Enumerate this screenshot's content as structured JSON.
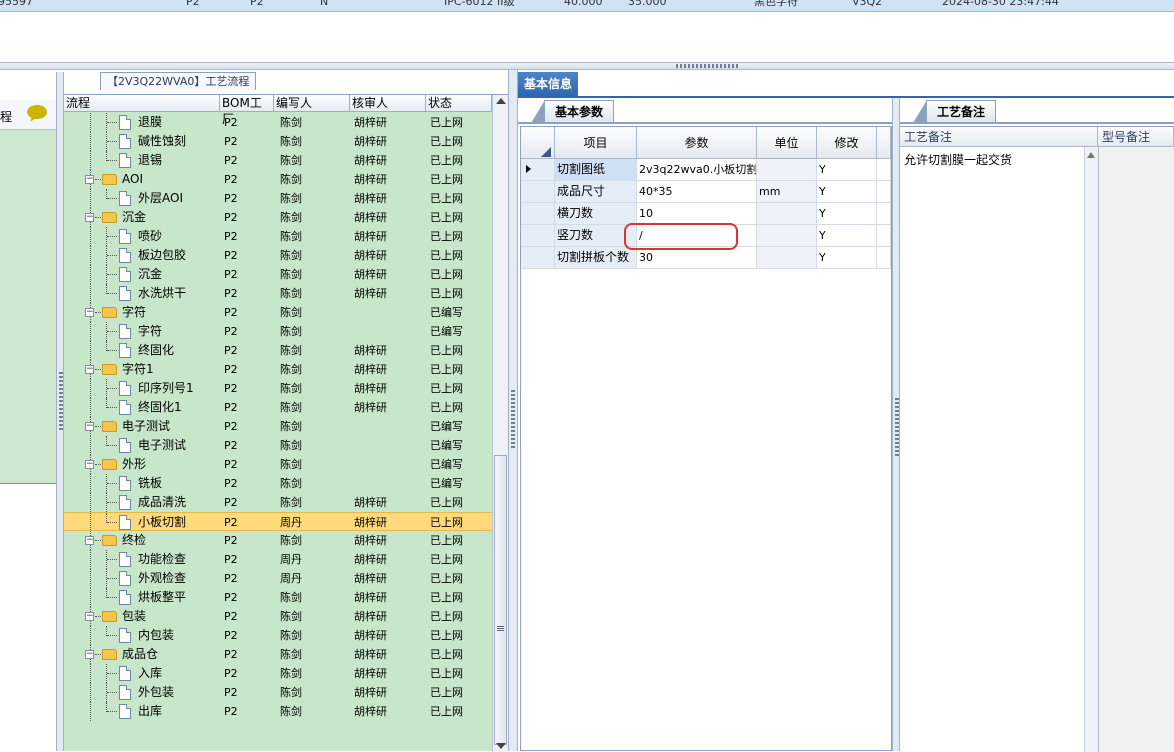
{
  "top_row": [
    "95597",
    "P2",
    "P2",
    "N",
    "IPC-6012 II级",
    "40.000",
    "35.000",
    "黑色字符",
    "V3Q2",
    "2024-08-30 23:47:44"
  ],
  "left_panel": {
    "label": "程"
  },
  "tree": {
    "title": "【2V3Q22WVA0】工艺流程",
    "columns": [
      "流程",
      "BOM工厂",
      "编写人",
      "核审人",
      "状态"
    ],
    "rows": [
      {
        "name": "退膜",
        "bom": "P2",
        "author": "陈剑",
        "reviewer": "胡梓研",
        "status": "已上网"
      },
      {
        "name": "碱性蚀刻",
        "bom": "P2",
        "author": "陈剑",
        "reviewer": "胡梓研",
        "status": "已上网"
      },
      {
        "name": "退锡",
        "bom": "P2",
        "author": "陈剑",
        "reviewer": "胡梓研",
        "status": "已上网"
      },
      {
        "name": "AOI",
        "bom": "P2",
        "author": "陈剑",
        "reviewer": "胡梓研",
        "status": "已上网"
      },
      {
        "name": "外层AOI",
        "bom": "P2",
        "author": "陈剑",
        "reviewer": "胡梓研",
        "status": "已上网"
      },
      {
        "name": "沉金",
        "bom": "P2",
        "author": "陈剑",
        "reviewer": "胡梓研",
        "status": "已上网"
      },
      {
        "name": "喷砂",
        "bom": "P2",
        "author": "陈剑",
        "reviewer": "胡梓研",
        "status": "已上网"
      },
      {
        "name": "板边包胶",
        "bom": "P2",
        "author": "陈剑",
        "reviewer": "胡梓研",
        "status": "已上网"
      },
      {
        "name": "沉金",
        "bom": "P2",
        "author": "陈剑",
        "reviewer": "胡梓研",
        "status": "已上网"
      },
      {
        "name": "水洗烘干",
        "bom": "P2",
        "author": "陈剑",
        "reviewer": "胡梓研",
        "status": "已上网"
      },
      {
        "name": "字符",
        "bom": "P2",
        "author": "陈剑",
        "reviewer": "",
        "status": "已编写"
      },
      {
        "name": "字符",
        "bom": "P2",
        "author": "陈剑",
        "reviewer": "",
        "status": "已编写"
      },
      {
        "name": "终固化",
        "bom": "P2",
        "author": "陈剑",
        "reviewer": "胡梓研",
        "status": "已上网"
      },
      {
        "name": "字符1",
        "bom": "P2",
        "author": "陈剑",
        "reviewer": "胡梓研",
        "status": "已上网"
      },
      {
        "name": "印序列号1",
        "bom": "P2",
        "author": "陈剑",
        "reviewer": "胡梓研",
        "status": "已上网"
      },
      {
        "name": "终固化1",
        "bom": "P2",
        "author": "陈剑",
        "reviewer": "胡梓研",
        "status": "已上网"
      },
      {
        "name": "电子测试",
        "bom": "P2",
        "author": "陈剑",
        "reviewer": "",
        "status": "已编写"
      },
      {
        "name": "电子测试",
        "bom": "P2",
        "author": "陈剑",
        "reviewer": "",
        "status": "已编写"
      },
      {
        "name": "外形",
        "bom": "P2",
        "author": "陈剑",
        "reviewer": "",
        "status": "已编写"
      },
      {
        "name": "铣板",
        "bom": "P2",
        "author": "陈剑",
        "reviewer": "",
        "status": "已编写"
      },
      {
        "name": "成品清洗",
        "bom": "P2",
        "author": "陈剑",
        "reviewer": "胡梓研",
        "status": "已上网"
      },
      {
        "name": "小板切割",
        "bom": "P2",
        "author": "周丹",
        "reviewer": "胡梓研",
        "status": "已上网"
      },
      {
        "name": "终检",
        "bom": "P2",
        "author": "陈剑",
        "reviewer": "胡梓研",
        "status": "已上网"
      },
      {
        "name": "功能检查",
        "bom": "P2",
        "author": "周丹",
        "reviewer": "胡梓研",
        "status": "已上网"
      },
      {
        "name": "外观检查",
        "bom": "P2",
        "author": "周丹",
        "reviewer": "胡梓研",
        "status": "已上网"
      },
      {
        "name": "烘板整平",
        "bom": "P2",
        "author": "陈剑",
        "reviewer": "胡梓研",
        "status": "已上网"
      },
      {
        "name": "包装",
        "bom": "P2",
        "author": "陈剑",
        "reviewer": "胡梓研",
        "status": "已上网"
      },
      {
        "name": "内包装",
        "bom": "P2",
        "author": "陈剑",
        "reviewer": "胡梓研",
        "status": "已上网"
      },
      {
        "name": "成品仓",
        "bom": "P2",
        "author": "陈剑",
        "reviewer": "胡梓研",
        "status": "已上网"
      },
      {
        "name": "入库",
        "bom": "P2",
        "author": "陈剑",
        "reviewer": "胡梓研",
        "status": "已上网"
      },
      {
        "name": "外包装",
        "bom": "P2",
        "author": "陈剑",
        "reviewer": "胡梓研",
        "status": "已上网"
      },
      {
        "name": "出库",
        "bom": "P2",
        "author": "陈剑",
        "reviewer": "胡梓研",
        "status": "已上网"
      }
    ]
  },
  "right": {
    "tab": "基本信息",
    "params_tab": "基本参数",
    "params_columns": [
      "项目",
      "参数",
      "单位",
      "修改"
    ],
    "params_rows": [
      {
        "item": "切割图纸",
        "value": "2v3q22wva0.小板切割",
        "unit": "",
        "modified": "Y"
      },
      {
        "item": "成品尺寸",
        "value": "40*35",
        "unit": "mm",
        "modified": "Y"
      },
      {
        "item": "横刀数",
        "value": "10",
        "unit": "",
        "modified": "Y"
      },
      {
        "item": "竖刀数",
        "value": "/",
        "unit": "",
        "modified": "Y"
      },
      {
        "item": "切割拼板个数",
        "value": "30",
        "unit": "",
        "modified": "Y"
      }
    ],
    "remarks_tab": "工艺备注",
    "remarks_col1": "工艺备注",
    "remarks_col2": "型号备注",
    "remarks_text": "允许切割膜一起交货"
  }
}
